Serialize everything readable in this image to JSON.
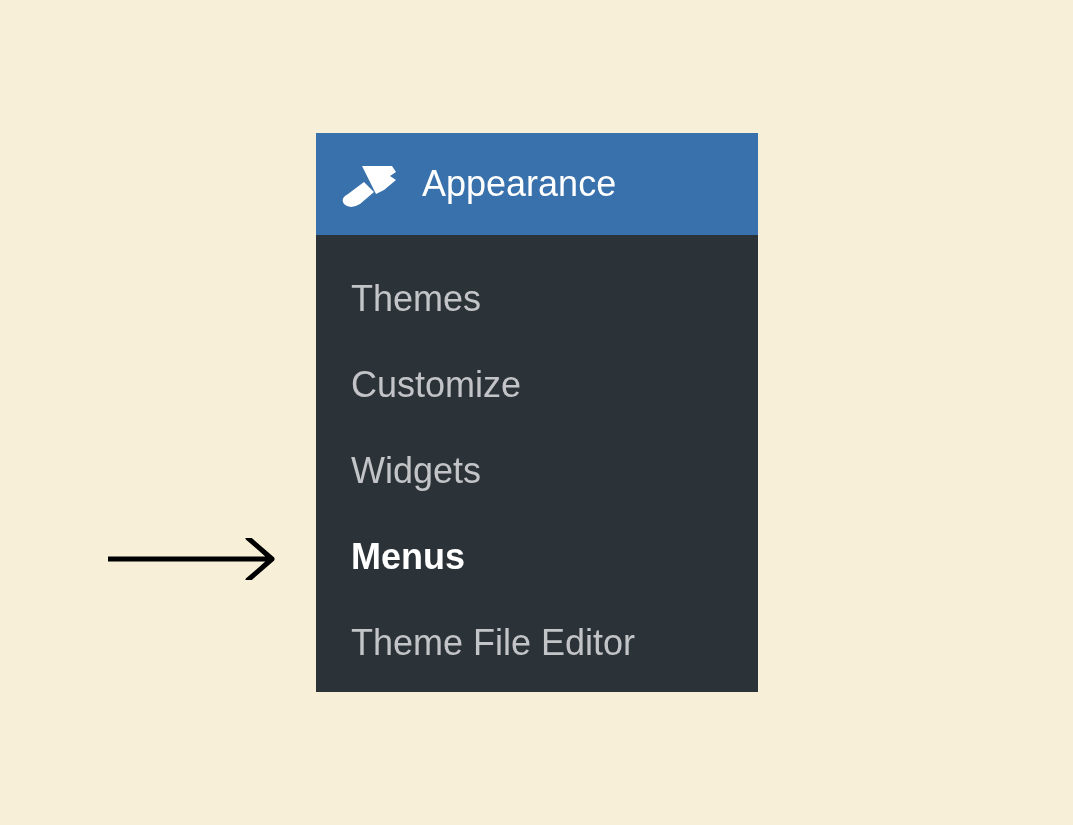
{
  "menu": {
    "title": "Appearance",
    "items": [
      {
        "label": "Themes",
        "selected": false
      },
      {
        "label": "Customize",
        "selected": false
      },
      {
        "label": "Widgets",
        "selected": false
      },
      {
        "label": "Menus",
        "selected": true
      },
      {
        "label": "Theme File Editor",
        "selected": false
      }
    ]
  }
}
